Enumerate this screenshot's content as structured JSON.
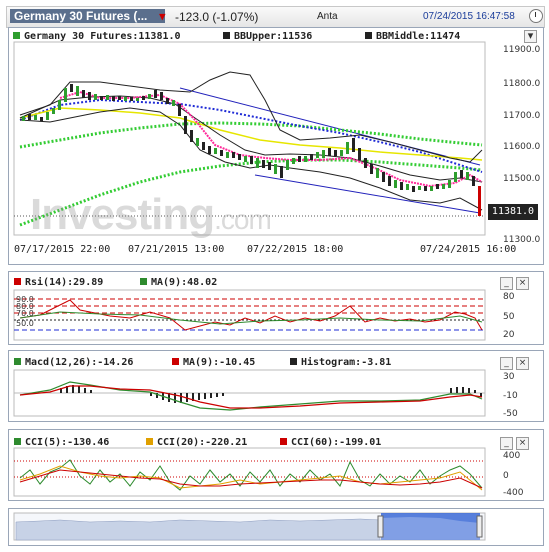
{
  "header": {
    "symbol": "Germany 30 Futures (...",
    "change": "-123.0 (-1.07%)",
    "source": "Anta",
    "datetime": "07/24/2015 16:47:58"
  },
  "main_chart": {
    "legend_symbol": "Germany 30 Futures:11381.0",
    "legend_bbupper": "BBUpper:11536",
    "legend_bbmiddle": "BBMiddle:11474",
    "y_ticks": [
      "11900.0",
      "11800.0",
      "11700.0",
      "11600.0",
      "11500.0",
      "11381.0",
      "11300.0"
    ],
    "x_labels": [
      "07/17/2015 22:00",
      "07/21/2015 13:00",
      "07/22/2015 18:00",
      "07/24/2015 16:00"
    ],
    "last_price": "11381.0",
    "watermark": "Investing",
    "watermark_suffix": ".com",
    "colors": {
      "up": "#2e9e2e",
      "down": "#222222",
      "bb": "#222222",
      "ma_blue": "#1f2bd6",
      "ma_green": "#33cc33",
      "ma_pink": "#ff2a9a",
      "ma_yellow": "#e6e600",
      "channel": "#2222bb"
    }
  },
  "rsi_panel": {
    "legend_rsi": "Rsi(14):29.89",
    "legend_ma": "MA(9):48.02",
    "y_ticks": [
      "80",
      "50",
      "20"
    ],
    "levels": [
      "90.0",
      "80.0",
      "70.0",
      "50.0"
    ]
  },
  "macd_panel": {
    "legend_macd": "Macd(12,26):-14.26",
    "legend_ma": "MA(9):-10.45",
    "legend_hist": "Histogram:-3.81",
    "y_ticks": [
      "30",
      "-10",
      "-50"
    ]
  },
  "cci_panel": {
    "legend_cci5": "CCI(5):-130.46",
    "legend_cci20": "CCI(20):-220.21",
    "legend_cci60": "CCI(60):-199.01",
    "y_ticks": [
      "400",
      "0",
      "-400"
    ]
  },
  "buttons": {
    "minimize": "_",
    "close": "×"
  }
}
